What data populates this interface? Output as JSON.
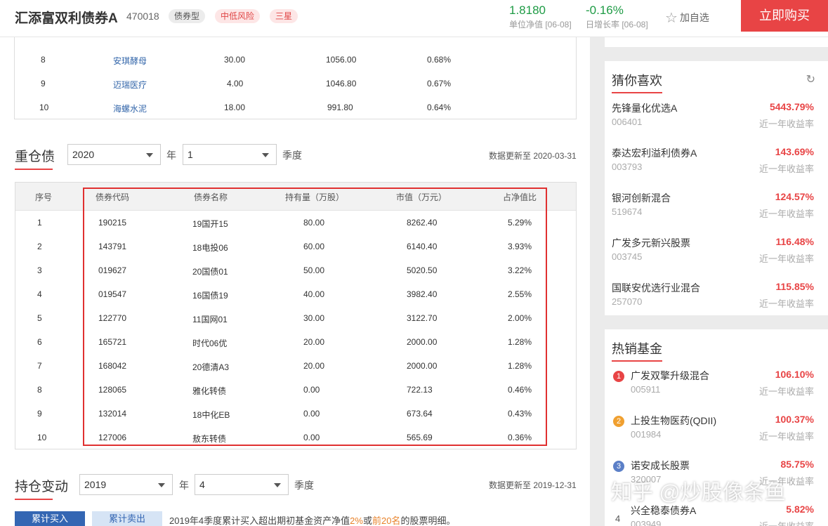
{
  "header": {
    "fund_name": "汇添富双利债券A",
    "fund_code": "470018",
    "tag_type": "债券型",
    "tag_risk": "中低风险",
    "tag_star": "三星",
    "nav_value": "1.8180",
    "nav_label": "单位净值 [06-08]",
    "growth_value": "-0.16%",
    "growth_label": "日增长率 [06-08]",
    "favorite_label": "加自选",
    "buy_label": "立即购买",
    "colors": {
      "up": "#e84445",
      "down": "#1e9b45"
    }
  },
  "stock_table": {
    "rows": [
      {
        "no": "8",
        "name": "安琪酵母",
        "shares": "30.00",
        "value": "1056.00",
        "pct": "0.68%"
      },
      {
        "no": "9",
        "name": "迈瑞医疗",
        "shares": "4.00",
        "value": "1046.80",
        "pct": "0.67%"
      },
      {
        "no": "10",
        "name": "海螺水泥",
        "shares": "18.00",
        "value": "991.80",
        "pct": "0.64%"
      }
    ]
  },
  "bond_section": {
    "title": "重仓债",
    "year": "2020",
    "year_unit": "年",
    "quarter": "1",
    "quarter_unit": "季度",
    "updated": "数据更新至 2020-03-31",
    "headers": [
      "序号",
      "债券代码",
      "债券名称",
      "持有量（万股）",
      "市值（万元）",
      "占净值比"
    ],
    "rows": [
      {
        "no": "1",
        "code": "190215",
        "name": "19国开15",
        "shares": "80.00",
        "value": "8262.40",
        "pct": "5.29%"
      },
      {
        "no": "2",
        "code": "143791",
        "name": "18电投06",
        "shares": "60.00",
        "value": "6140.40",
        "pct": "3.93%"
      },
      {
        "no": "3",
        "code": "019627",
        "name": "20国债01",
        "shares": "50.00",
        "value": "5020.50",
        "pct": "3.22%"
      },
      {
        "no": "4",
        "code": "019547",
        "name": "16国债19",
        "shares": "40.00",
        "value": "3982.40",
        "pct": "2.55%"
      },
      {
        "no": "5",
        "code": "122770",
        "name": "11国网01",
        "shares": "30.00",
        "value": "3122.70",
        "pct": "2.00%"
      },
      {
        "no": "6",
        "code": "165721",
        "name": "时代06优",
        "shares": "20.00",
        "value": "2000.00",
        "pct": "1.28%"
      },
      {
        "no": "7",
        "code": "168042",
        "name": "20德清A3",
        "shares": "20.00",
        "value": "2000.00",
        "pct": "1.28%"
      },
      {
        "no": "8",
        "code": "128065",
        "name": "雅化转债",
        "shares": "0.00",
        "value": "722.13",
        "pct": "0.46%"
      },
      {
        "no": "9",
        "code": "132014",
        "name": "18中化EB",
        "shares": "0.00",
        "value": "673.64",
        "pct": "0.43%"
      },
      {
        "no": "10",
        "code": "127006",
        "name": "敖东转债",
        "shares": "0.00",
        "value": "565.69",
        "pct": "0.36%"
      }
    ]
  },
  "change_section": {
    "title": "持仓变动",
    "year": "2019",
    "year_unit": "年",
    "quarter": "4",
    "quarter_unit": "季度",
    "updated": "数据更新至 2019-12-31",
    "btn_buy": "累计买入",
    "btn_sell": "累计卖出",
    "desc_pre": "2019年4季度累计买入超出期初基金资产净值",
    "desc_pct": "2%",
    "desc_mid": "或",
    "desc_top": "前20名",
    "desc_post": "的股票明细。"
  },
  "guess": {
    "title": "猜你喜欢",
    "refresh_icon": "refresh-icon",
    "items": [
      {
        "name": "先锋量化优选A",
        "code": "006401",
        "rate": "5443.79%",
        "rate_label": "近一年收益率"
      },
      {
        "name": "泰达宏利溢利债券A",
        "code": "003793",
        "rate": "143.69%",
        "rate_label": "近一年收益率"
      },
      {
        "name": "银河创新混合",
        "code": "519674",
        "rate": "124.57%",
        "rate_label": "近一年收益率"
      },
      {
        "name": "广发多元新兴股票",
        "code": "003745",
        "rate": "116.48%",
        "rate_label": "近一年收益率"
      },
      {
        "name": "国联安优选行业混合",
        "code": "257070",
        "rate": "115.85%",
        "rate_label": "近一年收益率"
      }
    ]
  },
  "hot": {
    "title": "热销基金",
    "items": [
      {
        "rank": "1",
        "rank_color": "#e84445",
        "name": "广发双擎升级混合",
        "code": "005911",
        "rate": "106.10%",
        "rate_label": "近一年收益率"
      },
      {
        "rank": "2",
        "rank_color": "#f0a030",
        "name": "上投生物医药(QDII)",
        "code": "001984",
        "rate": "100.37%",
        "rate_label": "近一年收益率"
      },
      {
        "rank": "3",
        "rank_color": "#5b7fc7",
        "name": "诺安成长股票",
        "code": "320007",
        "rate": "85.75%",
        "rate_label": "近一年收益率"
      },
      {
        "rank": "4",
        "rank_color": "",
        "name": "兴全稳泰债券A",
        "code": "003949",
        "rate": "5.82%",
        "rate_label": "近一年收益率"
      }
    ]
  },
  "watermark": "知乎 @炒股像条鱼"
}
